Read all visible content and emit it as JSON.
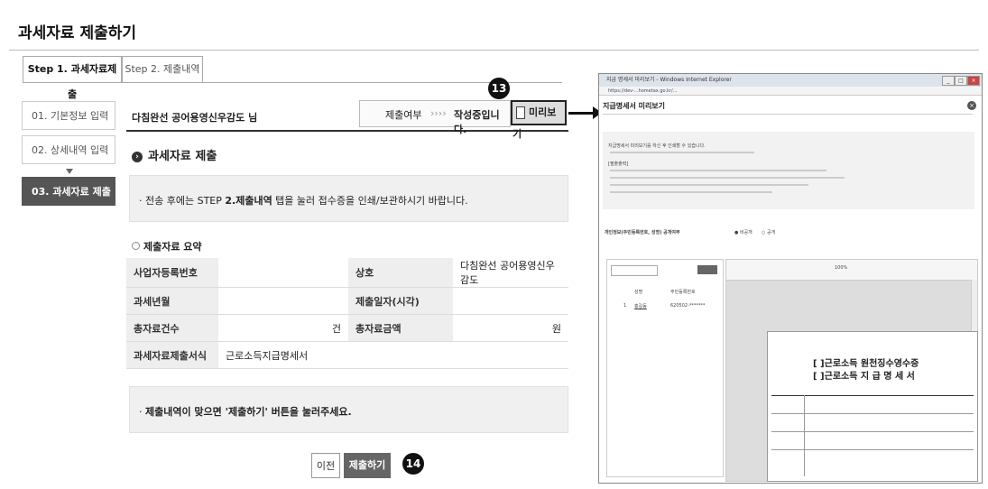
{
  "page_title": "과세자료 제출하기",
  "tabs": [
    {
      "label": "Step 1. 과세자료제출"
    },
    {
      "label": "Step 2. 제출내역"
    }
  ],
  "sidebar": [
    {
      "label": "01. 기본정보 입력"
    },
    {
      "label": "02. 상세내역 입력"
    },
    {
      "label": "03. 과세자료 제출"
    }
  ],
  "header": {
    "org_name": "다침완선 공어용영신우감도 님",
    "status_label": "제출여부",
    "status_arrows": "››››",
    "status_value": "작성중입니다.",
    "preview_label": "미리보기"
  },
  "badges": {
    "preview": "13",
    "submit": "14"
  },
  "section": {
    "title": "과세자료 제출",
    "notice_prefix": "전송 후에는 STEP ",
    "notice_bold": "2.제출내역",
    "notice_suffix": " 탭을 눌러 접수증을 인쇄/보관하시기 바랍니다."
  },
  "summary": {
    "title": "제출자료 요약",
    "rows": [
      {
        "l1": "사업자등록번호",
        "v1": "",
        "l2": "상호",
        "v2": "다침완선 공어용영신우감도"
      },
      {
        "l1": "과세년월",
        "v1": "",
        "l2": "제출일자(시각)",
        "v2": ""
      },
      {
        "l1": "총자료건수",
        "v1": "건",
        "l2": "총자료금액",
        "v2": "원"
      }
    ],
    "form_label": "과세자료제출서식",
    "form_value": "근로소득지급명세서"
  },
  "notice2": {
    "prefix": "제출내역이 맞으면 ",
    "bold": "'제출하기' 버튼을 눌러주세요."
  },
  "buttons": {
    "prev": "이전",
    "submit": "제출하기"
  },
  "popup": {
    "window_title": "지급 명세서 미리보기 - Windows Internet Explorer",
    "url": "https://dev-...hometax.go.kr/...",
    "heading": "지급명세서 미리보기",
    "info_lines": [
      "지급명세서 미리보기를 하신 후 인쇄할 수 있습니다.",
      "[필출출력]"
    ],
    "option_label": "개인정보(주민등록번호, 성명) 공개여부",
    "option_a": "비공개",
    "option_b": "공개",
    "list_headers": [
      "성명",
      "주민등록번호"
    ],
    "list_row": {
      "no": "1",
      "name": "홍길동",
      "id": "620502-*******"
    },
    "zoom": "100%",
    "doc_title_1": "[ ]근로소득 원천징수영수증",
    "doc_title_2": "[ ]근로소득 지 급 명 세 서"
  }
}
